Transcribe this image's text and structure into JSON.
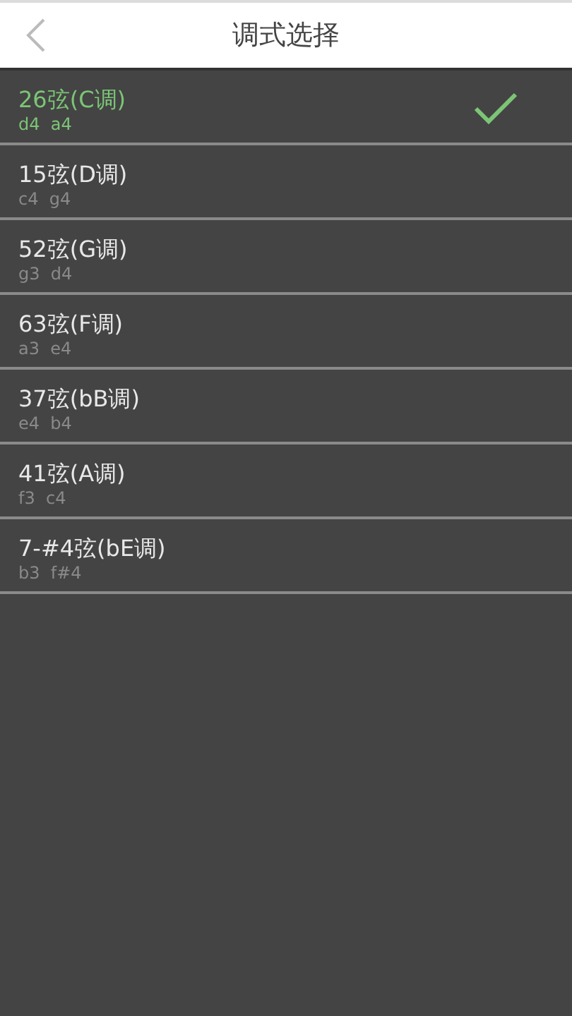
{
  "header": {
    "title": "调式选择"
  },
  "tunings": [
    {
      "name": "26弦(C调)",
      "notes": "d4  a4",
      "selected": true
    },
    {
      "name": "15弦(D调)",
      "notes": "c4  g4",
      "selected": false
    },
    {
      "name": "52弦(G调)",
      "notes": "g3  d4",
      "selected": false
    },
    {
      "name": "63弦(F调)",
      "notes": "a3  e4",
      "selected": false
    },
    {
      "name": "37弦(bB调)",
      "notes": "e4  b4",
      "selected": false
    },
    {
      "name": "41弦(A调)",
      "notes": "f3  c4",
      "selected": false
    },
    {
      "name": "7-#4弦(bE调)",
      "notes": "b3  f#4",
      "selected": false
    }
  ]
}
